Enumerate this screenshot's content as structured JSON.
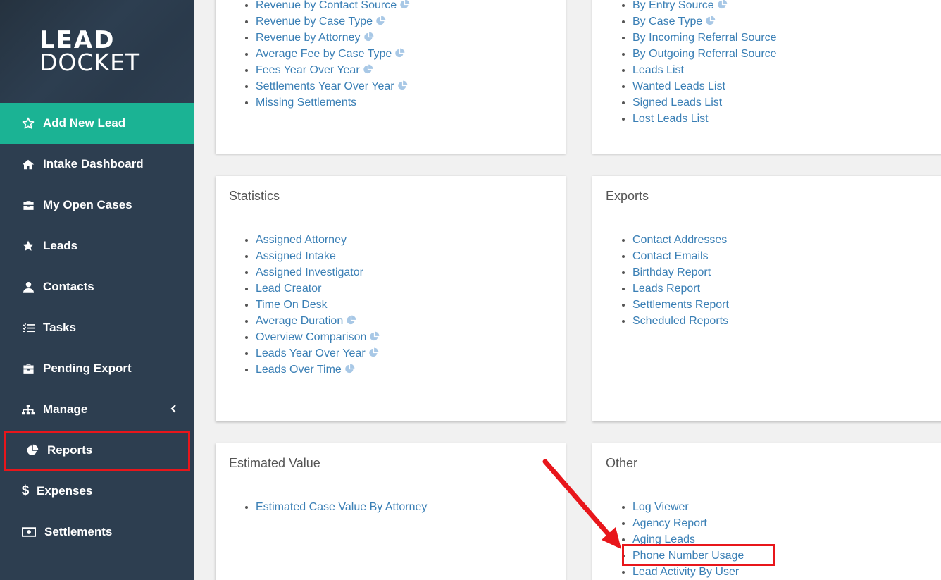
{
  "logo": {
    "line1": "LEAD",
    "line2": "DOCKET"
  },
  "sidebar": {
    "items": [
      {
        "label": "Add New Lead",
        "icon": "star-outline-icon"
      },
      {
        "label": "Intake Dashboard",
        "icon": "home-icon"
      },
      {
        "label": "My Open Cases",
        "icon": "briefcase-icon"
      },
      {
        "label": "Leads",
        "icon": "star-icon"
      },
      {
        "label": "Contacts",
        "icon": "user-icon"
      },
      {
        "label": "Tasks",
        "icon": "tasks-icon"
      },
      {
        "label": "Pending Export",
        "icon": "briefcase-icon"
      },
      {
        "label": "Manage",
        "icon": "sitemap-icon"
      },
      {
        "label": "Reports",
        "icon": "pie-chart-icon"
      },
      {
        "label": "Expenses",
        "icon": "dollar-icon"
      },
      {
        "label": "Settlements",
        "icon": "money-icon"
      }
    ],
    "active_color": "#1bb394",
    "bg_color": "#2d3e50"
  },
  "cards": {
    "revenue": {
      "links": [
        {
          "label": "Revenue by Contact Source",
          "chart": true
        },
        {
          "label": "Revenue by Case Type",
          "chart": true
        },
        {
          "label": "Revenue by Attorney",
          "chart": true
        },
        {
          "label": "Average Fee by Case Type",
          "chart": true
        },
        {
          "label": "Fees Year Over Year",
          "chart": true
        },
        {
          "label": "Settlements Year Over Year",
          "chart": true
        },
        {
          "label": "Missing Settlements",
          "chart": false
        }
      ]
    },
    "leads_by": {
      "links": [
        {
          "label": "By Entry Source",
          "chart": true
        },
        {
          "label": "By Case Type",
          "chart": true
        },
        {
          "label": "By Incoming Referral Source",
          "chart": false
        },
        {
          "label": "By Outgoing Referral Source",
          "chart": false
        },
        {
          "label": "Leads List",
          "chart": false
        },
        {
          "label": "Wanted Leads List",
          "chart": false
        },
        {
          "label": "Signed Leads List",
          "chart": false
        },
        {
          "label": "Lost Leads List",
          "chart": false
        }
      ]
    },
    "statistics": {
      "title": "Statistics",
      "links": [
        {
          "label": "Assigned Attorney",
          "chart": false
        },
        {
          "label": "Assigned Intake",
          "chart": false
        },
        {
          "label": "Assigned Investigator",
          "chart": false
        },
        {
          "label": "Lead Creator",
          "chart": false
        },
        {
          "label": "Time On Desk",
          "chart": false
        },
        {
          "label": "Average Duration",
          "chart": true
        },
        {
          "label": "Overview Comparison",
          "chart": true
        },
        {
          "label": "Leads Year Over Year",
          "chart": true
        },
        {
          "label": "Leads Over Time",
          "chart": true
        }
      ]
    },
    "exports": {
      "title": "Exports",
      "links": [
        {
          "label": "Contact Addresses",
          "chart": false
        },
        {
          "label": "Contact Emails",
          "chart": false
        },
        {
          "label": "Birthday Report",
          "chart": false
        },
        {
          "label": "Leads Report",
          "chart": false
        },
        {
          "label": "Settlements Report",
          "chart": false
        },
        {
          "label": "Scheduled Reports",
          "chart": false
        }
      ]
    },
    "estimated": {
      "title": "Estimated Value",
      "links": [
        {
          "label": "Estimated Case Value By Attorney",
          "chart": false
        }
      ]
    },
    "other": {
      "title": "Other",
      "links": [
        {
          "label": "Log Viewer",
          "chart": false
        },
        {
          "label": "Agency Report",
          "chart": false
        },
        {
          "label": "Aging Leads",
          "chart": false
        },
        {
          "label": "Phone Number Usage",
          "chart": false
        },
        {
          "label": "Lead Activity By User",
          "chart": false
        }
      ]
    }
  },
  "colors": {
    "link": "#3a7fb5",
    "highlight": "#e8161b",
    "chart_icon": "#a8c8e6"
  }
}
